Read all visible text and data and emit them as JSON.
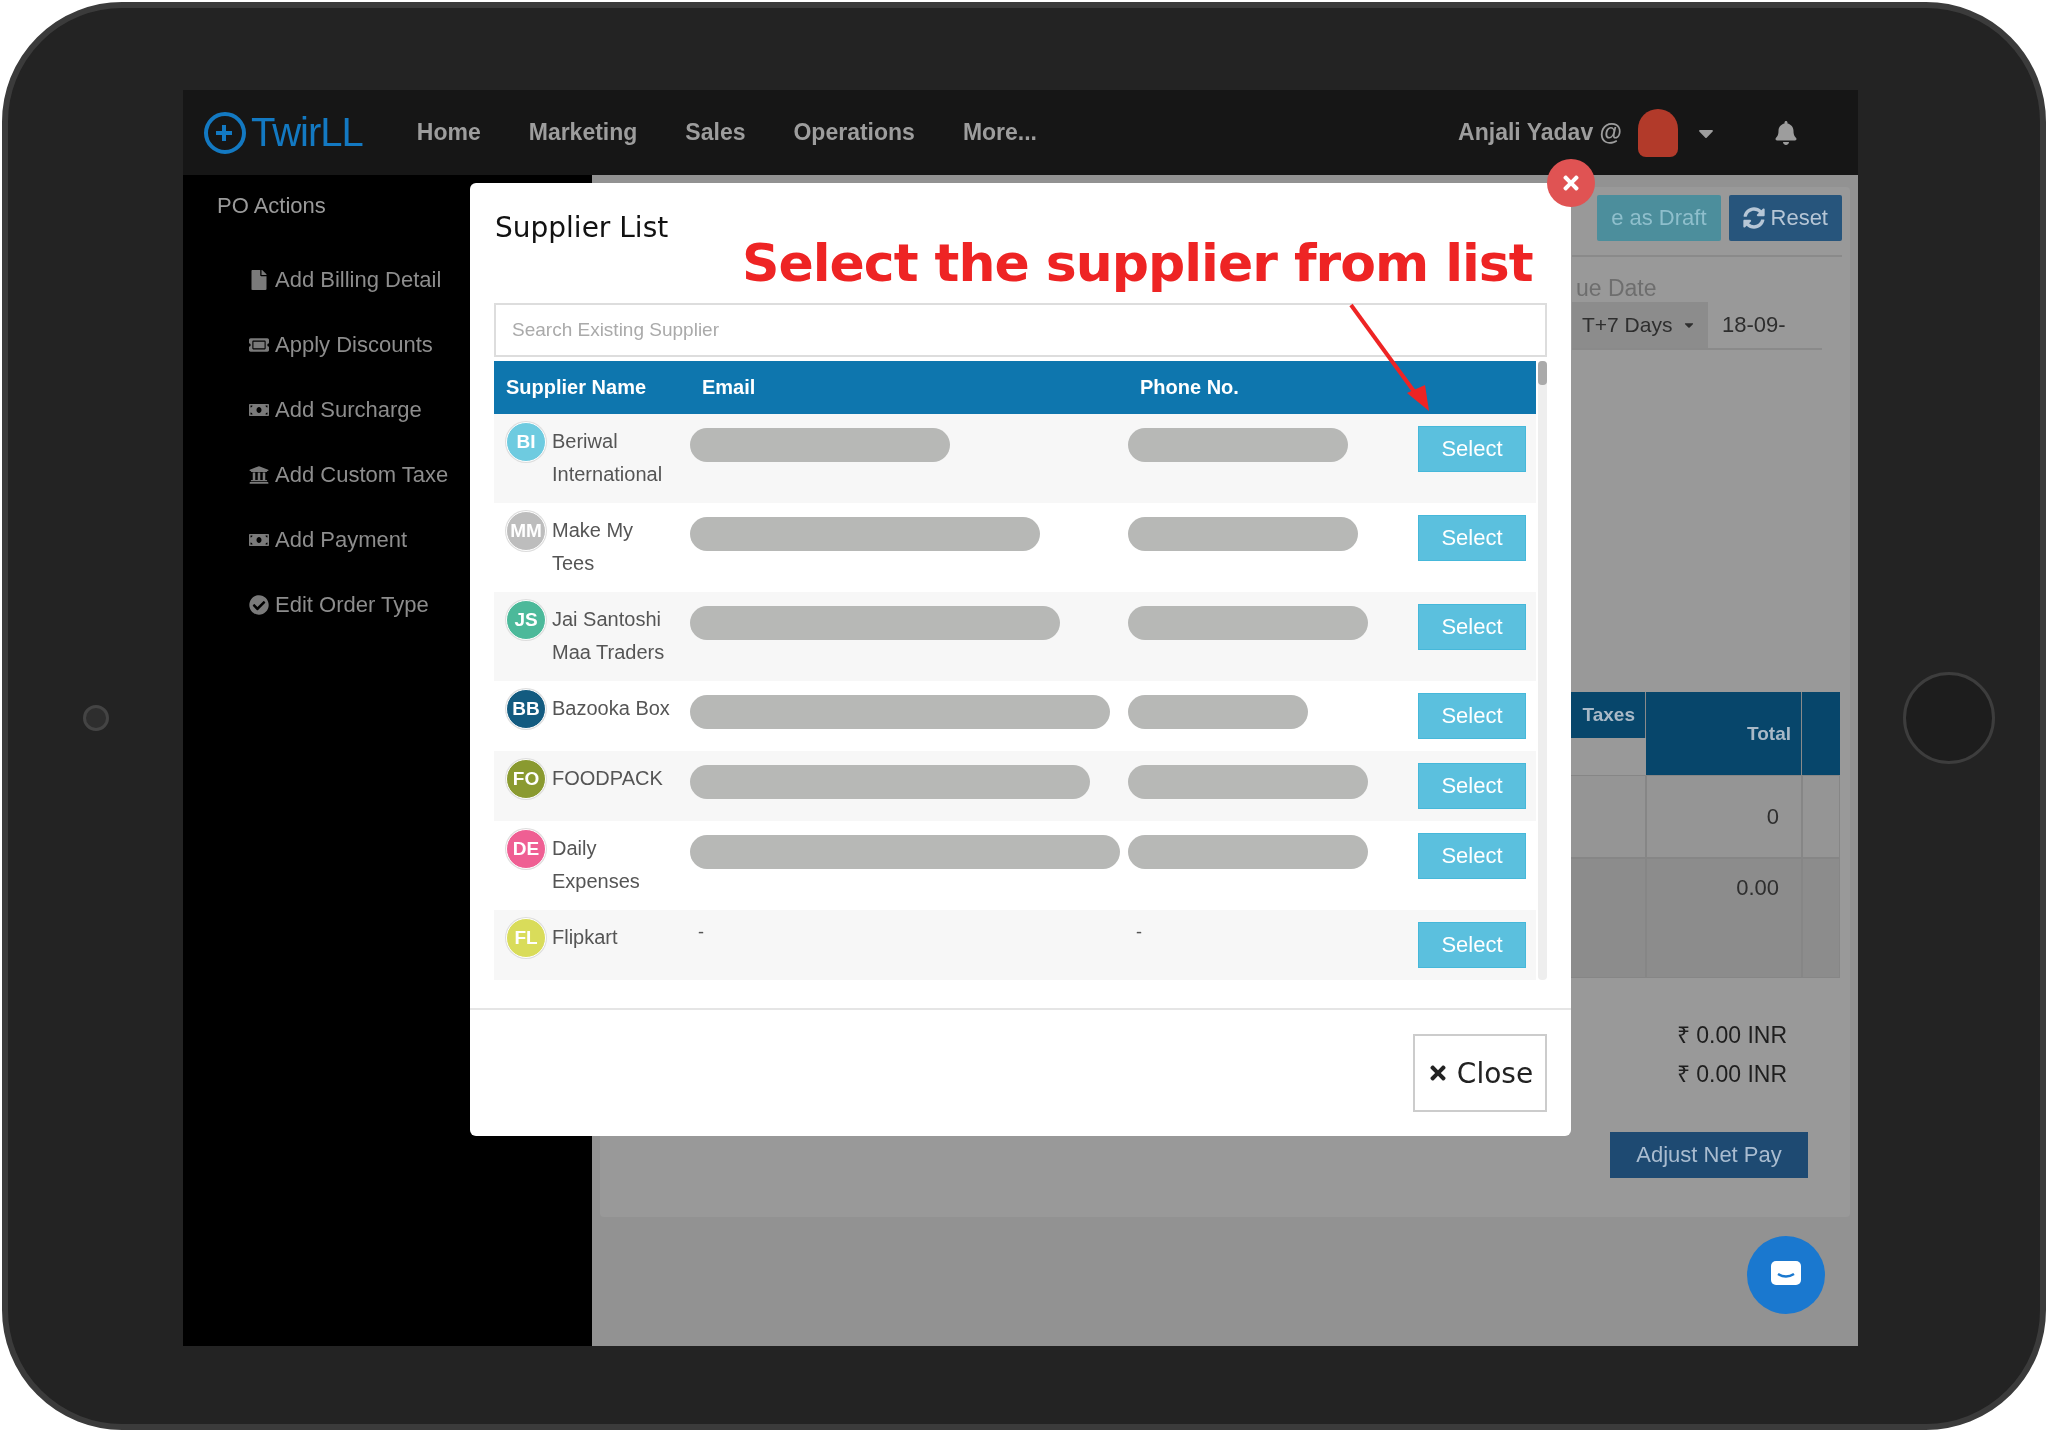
{
  "nav": {
    "logo": "TwirLL",
    "items": [
      "Home",
      "Marketing",
      "Sales",
      "Operations",
      "More..."
    ],
    "user": "Anjali Yadav @"
  },
  "sidebar": {
    "heading": "PO Actions",
    "items": [
      {
        "label": "Add Billing Detail",
        "kind": "file"
      },
      {
        "label": "Apply Discounts",
        "kind": "tag"
      },
      {
        "label": "Add Surcharge",
        "kind": "money"
      },
      {
        "label": "Add Custom Taxe",
        "kind": "bank"
      },
      {
        "label": "Add Payment",
        "kind": "money"
      },
      {
        "label": "Edit Order Type",
        "kind": "check"
      }
    ]
  },
  "background": {
    "buttons": [
      {
        "label": "e as Draft",
        "kind": "draft"
      },
      {
        "label": "Reset",
        "kind": "reset"
      }
    ],
    "due_date_label": "ue Date",
    "terms": "T+7 Days",
    "date": "18-09-",
    "table": {
      "columns": [
        "Taxes",
        "Total"
      ],
      "totals_column": [
        "0",
        "0.00"
      ]
    },
    "totals": [
      "₹ 0.00 INR",
      "₹ 0.00 INR"
    ],
    "adjust_button": "Adjust Net Pay"
  },
  "modal": {
    "title": "Supplier List",
    "annotation": "Select the supplier from list",
    "search": {
      "placeholder": "Search Existing Supplier"
    },
    "columns": [
      "Supplier Name",
      "Email",
      "Phone No."
    ],
    "rows": [
      {
        "initials": "BI",
        "name": "Beriwal International",
        "color": "#6ecbe0",
        "email": {
          "kind": "redacted"
        },
        "phone": {
          "kind": "redacted"
        },
        "action": "Select"
      },
      {
        "initials": "MM",
        "name": "Make My Tees",
        "color": "#bdbdbd",
        "email": {
          "kind": "redacted"
        },
        "phone": {
          "kind": "redacted"
        },
        "action": "Select"
      },
      {
        "initials": "JS",
        "name": "Jai Santoshi Maa Traders",
        "color": "#4cb99a",
        "email": {
          "kind": "redacted"
        },
        "phone": {
          "kind": "redacted"
        },
        "action": "Select"
      },
      {
        "initials": "BB",
        "name": "Bazooka Box",
        "color": "#135b80",
        "email": {
          "kind": "redacted"
        },
        "phone": {
          "kind": "redacted"
        },
        "action": "Select"
      },
      {
        "initials": "FO",
        "name": "FOODPACK",
        "color": "#8a9a30",
        "email": {
          "kind": "redacted"
        },
        "phone": {
          "kind": "redacted"
        },
        "action": "Select"
      },
      {
        "initials": "DE",
        "name": "Daily Expenses",
        "color": "#ef5f93",
        "email": {
          "kind": "redacted"
        },
        "phone": {
          "kind": "redacted"
        },
        "action": "Select"
      },
      {
        "initials": "FL",
        "name": "Flipkart",
        "color": "#d9dc5a",
        "email": {
          "kind": "text",
          "text": "-"
        },
        "phone": {
          "kind": "text",
          "text": "-"
        },
        "action": "Select"
      }
    ],
    "close_button": "Close"
  }
}
